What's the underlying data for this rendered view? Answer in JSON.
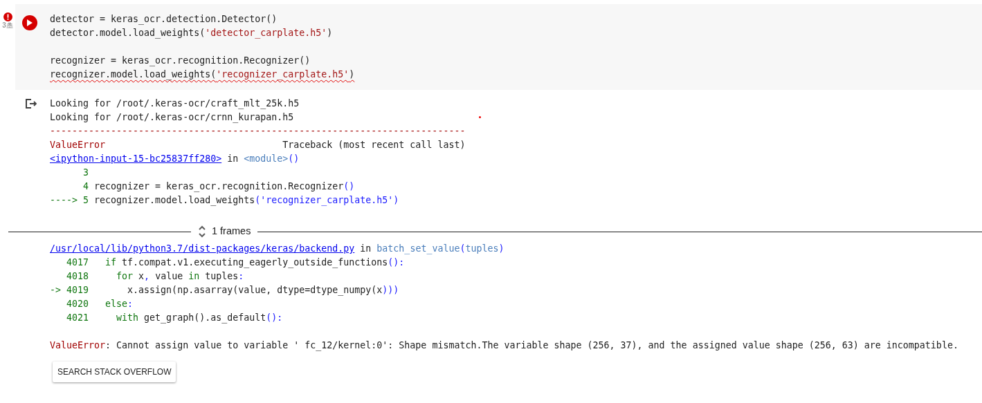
{
  "cell": {
    "status": {
      "kind": "error",
      "duration": "3초"
    },
    "code": [
      {
        "tokens": [
          {
            "kind": "text",
            "t": "detector = keras_ocr.detection.Detector()"
          }
        ]
      },
      {
        "tokens": [
          {
            "kind": "text",
            "t": "detector.model.load_weights("
          },
          {
            "kind": "str",
            "t": "'detector_carplate.h5'"
          },
          {
            "kind": "text",
            "t": ")"
          }
        ]
      },
      {
        "kind": "blank"
      },
      {
        "tokens": [
          {
            "kind": "text",
            "t": "recognizer = keras_ocr.recognition.Recognizer()"
          }
        ]
      },
      {
        "squiggle": true,
        "tokens": [
          {
            "kind": "text",
            "t": "recognizer.model.load_weights("
          },
          {
            "kind": "str",
            "t": "'recognizer_carplate.h5'"
          },
          {
            "kind": "text",
            "t": ")"
          }
        ]
      }
    ]
  },
  "output": {
    "before": [
      {
        "tokens": [
          {
            "kind": "text",
            "t": "Looking for /root/.keras-ocr/craft_mlt_25k.h5"
          }
        ]
      },
      {
        "tokens": [
          {
            "kind": "text",
            "t": "Looking for /root/.keras-ocr/crnn_kurapan.h5"
          }
        ]
      },
      {
        "tokens": [
          {
            "kind": "err",
            "t": "---------------------------------------------------------------------------"
          }
        ]
      },
      {
        "tokens": [
          {
            "kind": "err",
            "t": "ValueError"
          },
          {
            "kind": "text",
            "t": "                                Traceback (most recent call last)"
          }
        ]
      },
      {
        "tokens": [
          {
            "kind": "link",
            "t": "<ipython-input-15-bc25837ff280>"
          },
          {
            "kind": "text",
            "t": " in "
          },
          {
            "kind": "func",
            "t": "<module>"
          },
          {
            "kind": "punct",
            "t": "()"
          }
        ]
      },
      {
        "tokens": [
          {
            "kind": "num",
            "t": "      3"
          }
        ]
      },
      {
        "tokens": [
          {
            "kind": "num",
            "t": "      4 "
          },
          {
            "kind": "text",
            "t": "recognizer = keras_ocr.recognition.Recognizer"
          },
          {
            "kind": "punct",
            "t": "()"
          }
        ]
      },
      {
        "tokens": [
          {
            "kind": "num",
            "t": "----> 5 "
          },
          {
            "kind": "text",
            "t": "recognizer.model.load_weights"
          },
          {
            "kind": "punct",
            "t": "('recognizer_carplate.h5')"
          }
        ]
      }
    ],
    "frames": {
      "label": "1 frames"
    },
    "after": [
      {
        "tokens": [
          {
            "kind": "link",
            "t": "/usr/local/lib/python3.7/dist-packages/keras/backend.py"
          },
          {
            "kind": "text",
            "t": " in "
          },
          {
            "kind": "func",
            "t": "batch_set_value"
          },
          {
            "kind": "punct",
            "t": "("
          },
          {
            "kind": "func",
            "t": "tuples"
          },
          {
            "kind": "punct",
            "t": ")"
          }
        ]
      },
      {
        "tokens": [
          {
            "kind": "num",
            "t": "   4017   if "
          },
          {
            "kind": "text",
            "t": "tf.compat.v1.executing_eagerly_outside_functions"
          },
          {
            "kind": "punct",
            "t": "():"
          }
        ]
      },
      {
        "tokens": [
          {
            "kind": "num",
            "t": "   4018     for "
          },
          {
            "kind": "text",
            "t": "x"
          },
          {
            "kind": "punct",
            "t": ", "
          },
          {
            "kind": "text",
            "t": "value "
          },
          {
            "kind": "num",
            "t": "in "
          },
          {
            "kind": "text",
            "t": "tuples"
          },
          {
            "kind": "punct",
            "t": ":"
          }
        ]
      },
      {
        "tokens": [
          {
            "kind": "num",
            "t": "-> 4019       "
          },
          {
            "kind": "text",
            "t": "x.assign(np.asarray(value, dtype=dtype_numpy(x"
          },
          {
            "kind": "punct",
            "t": ")))"
          }
        ]
      },
      {
        "tokens": [
          {
            "kind": "num",
            "t": "   4020   else"
          },
          {
            "kind": "punct",
            "t": ":"
          }
        ]
      },
      {
        "tokens": [
          {
            "kind": "num",
            "t": "   4021     with "
          },
          {
            "kind": "text",
            "t": "get_graph().as_default"
          },
          {
            "kind": "punct",
            "t": "():"
          }
        ]
      },
      {
        "kind": "blank"
      },
      {
        "tokens": [
          {
            "kind": "err",
            "t": "ValueError"
          },
          {
            "kind": "text",
            "t": ": Cannot assign value to variable ' fc_12/kernel:0': Shape mismatch.The variable shape (256, 37), and the assigned value shape (256, 63) are incompatible."
          }
        ]
      }
    ],
    "button": "SEARCH STACK OVERFLOW"
  }
}
